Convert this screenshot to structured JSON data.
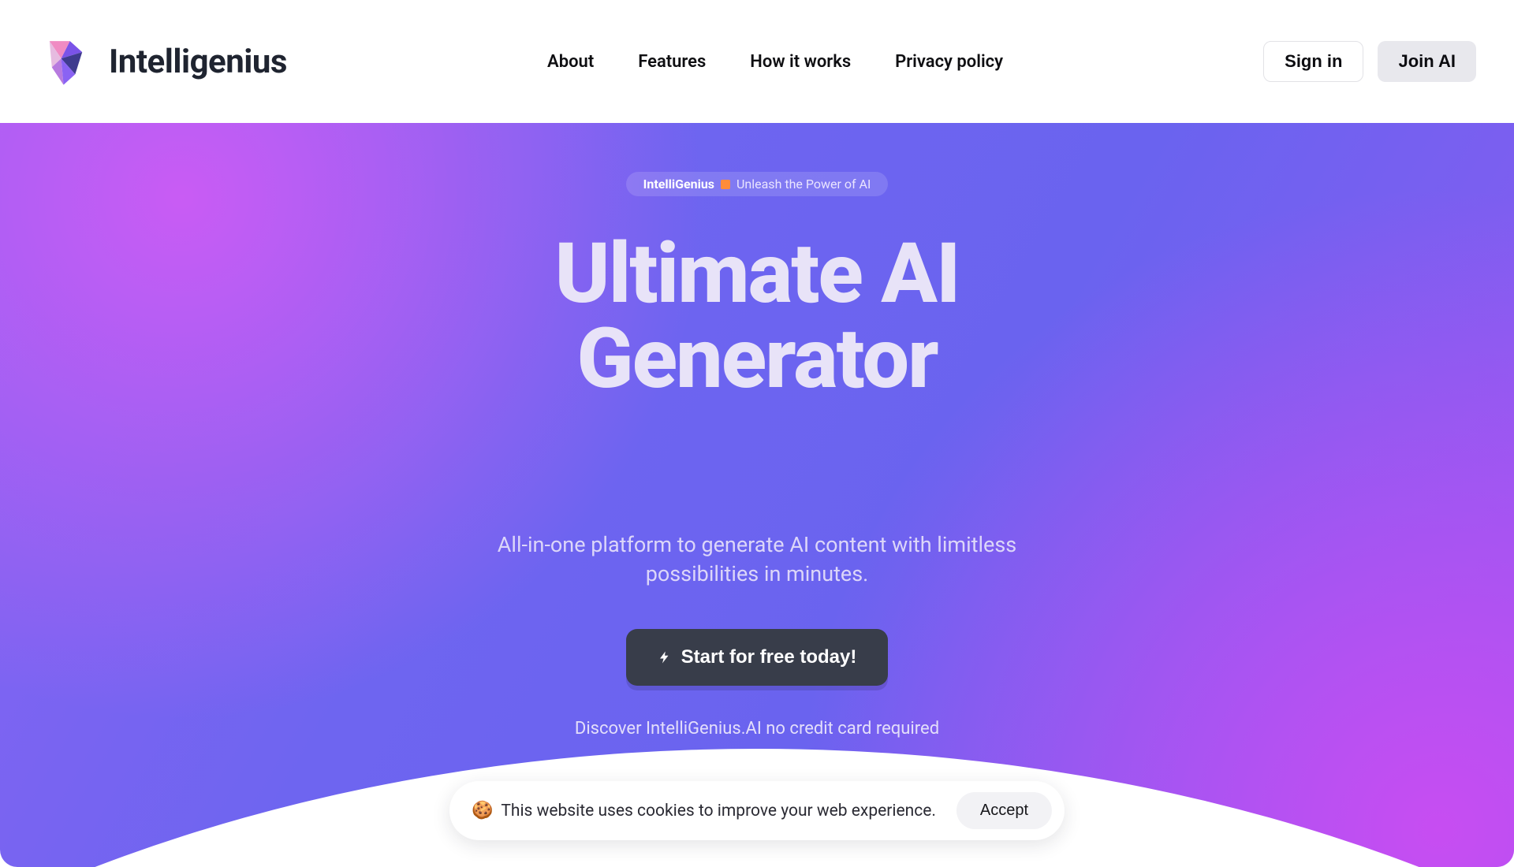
{
  "brand": {
    "name": "Intelligenius"
  },
  "nav": {
    "items": [
      {
        "label": "About"
      },
      {
        "label": "Features"
      },
      {
        "label": "How it works"
      },
      {
        "label": "Privacy policy"
      }
    ]
  },
  "actions": {
    "signin": "Sign in",
    "join": "Join AI"
  },
  "hero": {
    "pill_strong": "IntelliGenius",
    "pill_rest": "Unleash the Power of AI",
    "headline_line1": "Ultimate AI",
    "headline_line2": "Generator",
    "subhead": "All-in-one platform to generate AI content with limitless possibilities in minutes.",
    "cta_label": "Start for free today!",
    "discover": "Discover IntelliGenius.AI no credit card required"
  },
  "cookie": {
    "text": "This website uses cookies to improve your web experience.",
    "accept": "Accept"
  }
}
